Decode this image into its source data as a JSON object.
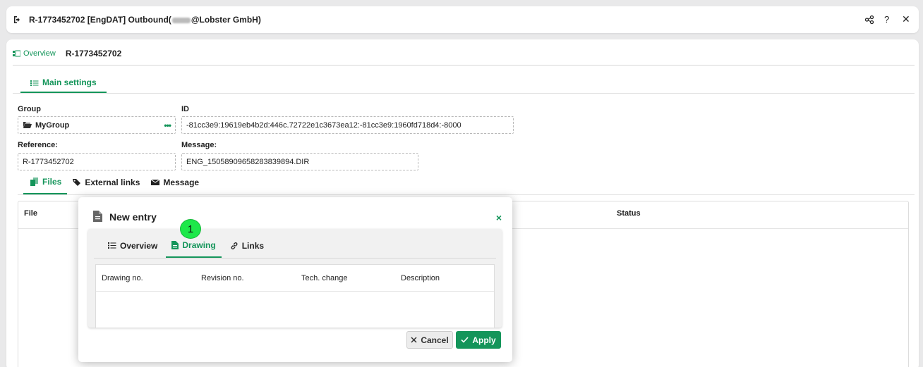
{
  "titlebar": {
    "title_prefix": "R-1773452702 [EngDAT] Outbound(",
    "title_suffix": "@Lobster GmbH)",
    "icons": [
      "exit-icon",
      "share-icon",
      "help-icon",
      "close-icon"
    ],
    "help_label": "?",
    "close_label": "✕"
  },
  "breadcrumb": {
    "overview": "Overview",
    "current": "R-1773452702"
  },
  "main_tab": {
    "label": "Main settings"
  },
  "fields": {
    "group_label": "Group",
    "group_value": "MyGroup",
    "group_more": "•••",
    "id_label": "ID",
    "id_value": "-81cc3e9:19619eb4b2d:446c.72722e1c3673ea12:-81cc3e9:1960fd718d4:-8000",
    "reference_label": "Reference:",
    "reference_value": "R-1773452702",
    "message_label": "Message:",
    "message_value": "ENG_15058909658283839894.DIR"
  },
  "subtabs": [
    {
      "label": "Files",
      "icon": "files-icon"
    },
    {
      "label": "External links",
      "icon": "tags-icon"
    },
    {
      "label": "Message",
      "icon": "envelope-icon"
    }
  ],
  "files_grid": {
    "col_file": "File",
    "col_status": "Status"
  },
  "dialog": {
    "title": "New entry",
    "close": "×",
    "tabs": [
      {
        "label": "Overview",
        "icon": "list-icon"
      },
      {
        "label": "Drawing",
        "icon": "drawing-icon"
      },
      {
        "label": "Links",
        "icon": "link-icon"
      }
    ],
    "columns": [
      "Drawing no.",
      "Revision no.",
      "Tech. change",
      "Description"
    ],
    "cancel_label": "Cancel",
    "apply_label": "Apply"
  },
  "marker": {
    "label": "1"
  },
  "colors": {
    "accent": "#14955a",
    "marker": "#1ee84a"
  }
}
